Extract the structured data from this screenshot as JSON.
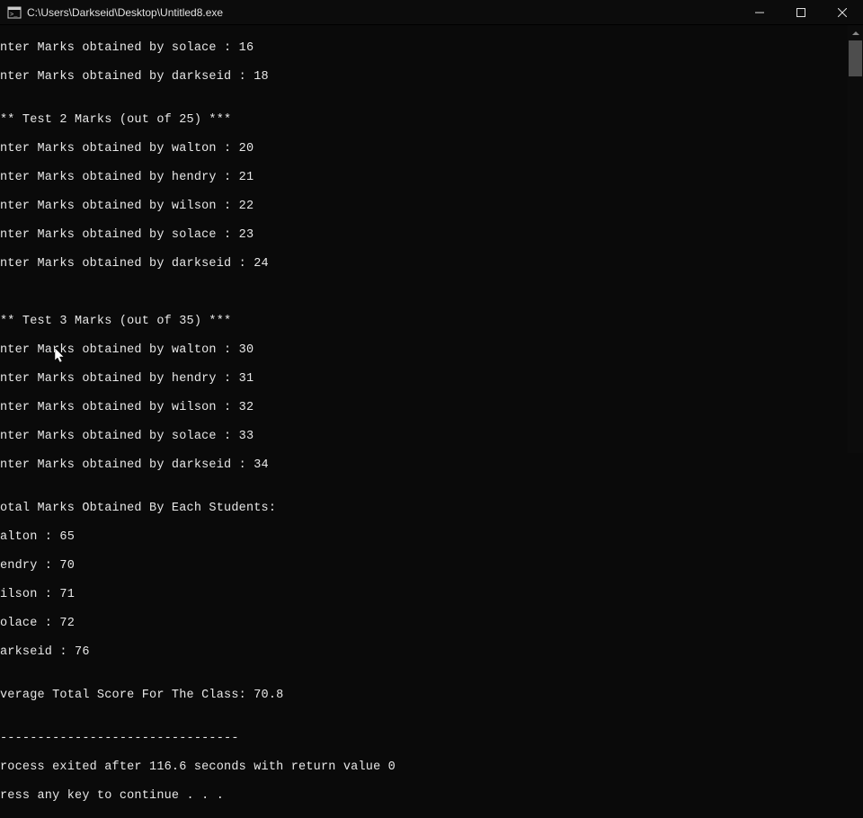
{
  "window": {
    "title": "C:\\Users\\Darkseid\\Desktop\\Untitled8.exe"
  },
  "lines": {
    "l0": "nter Marks obtained by solace : 16",
    "l1": "nter Marks obtained by darkseid : 18",
    "l2": "",
    "l3": "** Test 2 Marks (out of 25) ***",
    "l4": "nter Marks obtained by walton : 20",
    "l5": "nter Marks obtained by hendry : 21",
    "l6": "nter Marks obtained by wilson : 22",
    "l7": "nter Marks obtained by solace : 23",
    "l8": "nter Marks obtained by darkseid : 24",
    "l9": "",
    "l10": "",
    "l11": "** Test 3 Marks (out of 35) ***",
    "l12": "nter Marks obtained by walton : 30",
    "l13": "nter Marks obtained by hendry : 31",
    "l14": "nter Marks obtained by wilson : 32",
    "l15": "nter Marks obtained by solace : 33",
    "l16": "nter Marks obtained by darkseid : 34",
    "l17": "",
    "l18": "otal Marks Obtained By Each Students:",
    "l19": "alton : 65",
    "l20": "endry : 70",
    "l21": "ilson : 71",
    "l22": "olace : 72",
    "l23": "arkseid : 76",
    "l24": "",
    "l25": "verage Total Score For The Class: 70.8",
    "l26": "",
    "l27": "--------------------------------",
    "l28": "rocess exited after 116.6 seconds with return value 0",
    "l29": "ress any key to continue . . ."
  }
}
